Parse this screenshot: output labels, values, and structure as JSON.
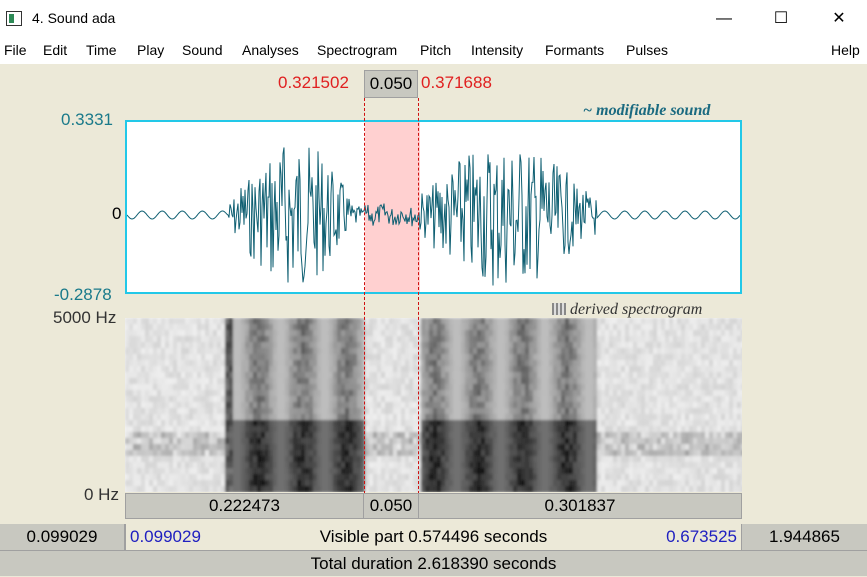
{
  "window": {
    "title": "4. Sound ada",
    "minimize": "—",
    "maximize": "☐",
    "close": "✕"
  },
  "menu": {
    "file": "File",
    "edit": "Edit",
    "time": "Time",
    "play": "Play",
    "sound": "Sound",
    "analyses": "Analyses",
    "spectrogram": "Spectrogram",
    "pitch": "Pitch",
    "intensity": "Intensity",
    "formants": "Formants",
    "pulses": "Pulses",
    "help": "Help"
  },
  "selection": {
    "start": "0.321502",
    "duration": "0.050",
    "end": "0.371688"
  },
  "waveform": {
    "label": "~ modifiable sound",
    "max": "0.3331",
    "zero": "0",
    "min": "-0.2878"
  },
  "spectrogram": {
    "label": "derived spectrogram",
    "top": "5000 Hz",
    "bottom": "0 Hz"
  },
  "timebar": {
    "left": "0.222473",
    "selection": "0.050",
    "right": "0.301837"
  },
  "visible": {
    "before": "0.099029",
    "start": "0.099029",
    "text": "Visible part 0.574496 seconds",
    "end": "0.673525",
    "after": "1.944865"
  },
  "total": {
    "text": "Total duration 2.618390 seconds"
  },
  "colors": {
    "axis_teal": "#1a7a8a",
    "selection_red": "#e02020",
    "wave": "#0f5f72",
    "frame_cyan": "#22c8e8",
    "selection_fill": "#ffd0d0",
    "link_blue": "#2020c0"
  }
}
